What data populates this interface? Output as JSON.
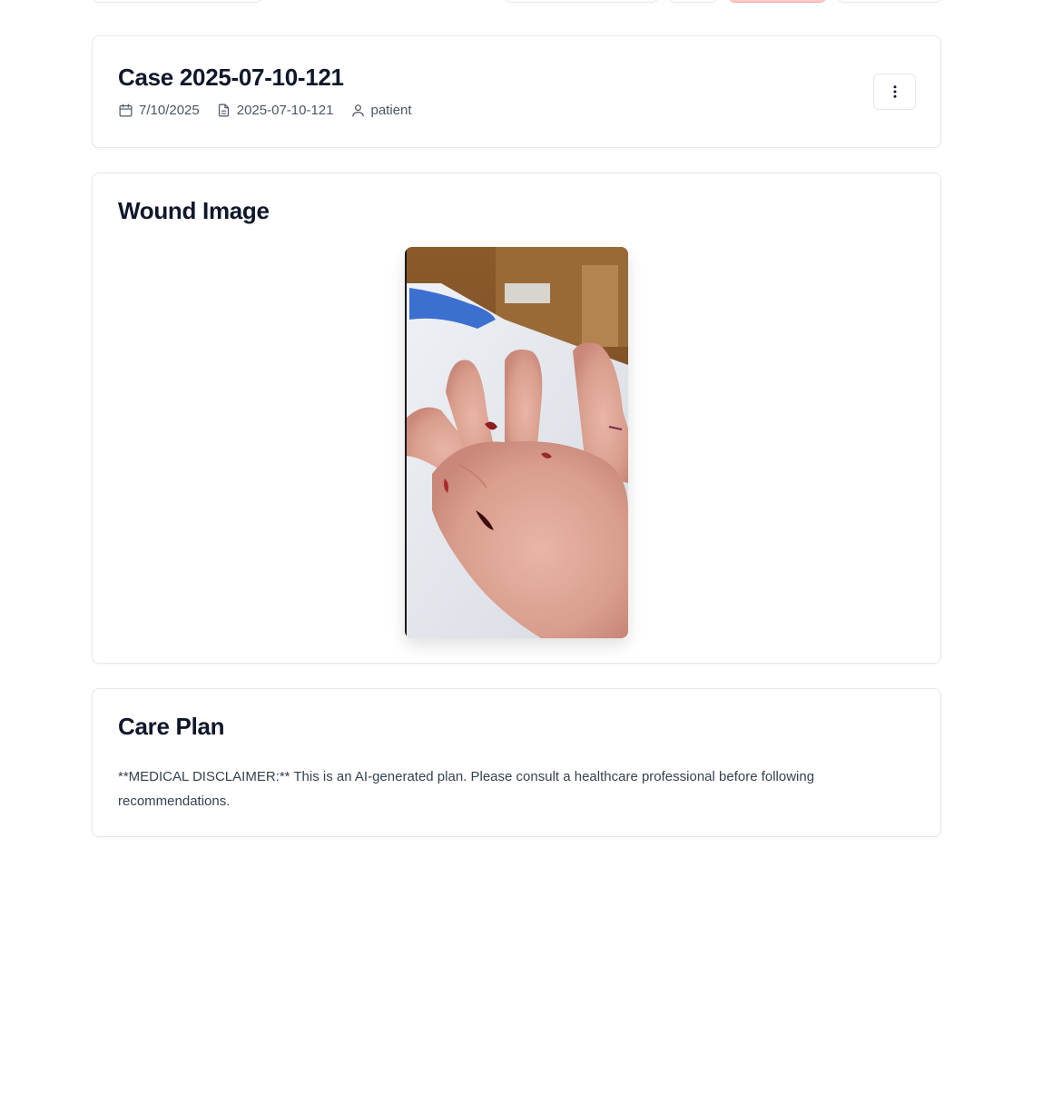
{
  "case": {
    "title": "Case 2025-07-10-121",
    "date": "7/10/2025",
    "case_id": "2025-07-10-121",
    "role": "patient"
  },
  "wound_image": {
    "title": "Wound Image",
    "image_semantic": "photo of injured hand with cuts on knuckles"
  },
  "care_plan": {
    "title": "Care Plan",
    "text": "**MEDICAL DISCLAIMER:** This is an AI-generated plan. Please consult a healthcare professional before following recommendations."
  },
  "icons": {
    "date": "calendar-icon",
    "case_id": "document-icon",
    "role": "user-icon",
    "menu": "more-vertical-icon"
  },
  "colors": {
    "danger_border": "#fca5a5",
    "border": "#e5e7eb",
    "muted_text": "#4b5563"
  }
}
